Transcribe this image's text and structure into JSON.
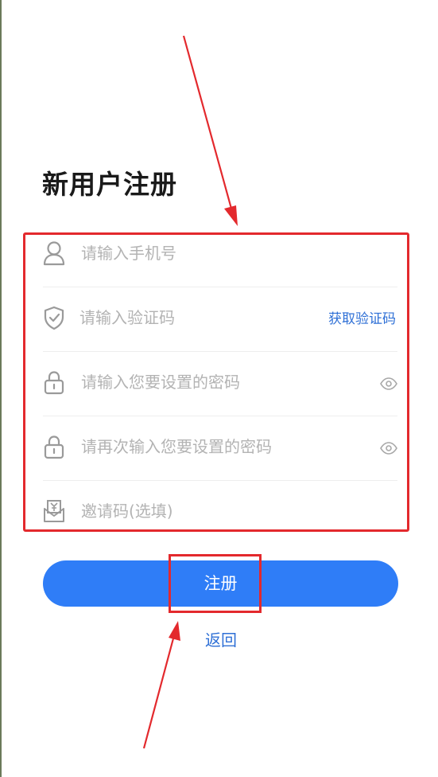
{
  "page_title": "新用户注册",
  "form": {
    "phone_placeholder": "请输入手机号",
    "code_placeholder": "请输入验证码",
    "get_code_label": "获取验证码",
    "password_placeholder": "请输入您要设置的密码",
    "confirm_password_placeholder": "请再次输入您要设置的密码",
    "invite_placeholder": "邀请码(选填)"
  },
  "register_label": "注册",
  "back_label": "返回",
  "colors": {
    "accent": "#2f7df7",
    "link": "#2f70d6",
    "annotation": "#e3292d",
    "placeholder": "#b3b3b3",
    "icon": "#9a9a9a"
  },
  "icons": {
    "phone": "user-icon",
    "code": "shield-check-icon",
    "password": "lock-icon",
    "confirm_password": "lock-icon",
    "invite": "envelope-yuan-icon",
    "toggle": "eye-icon"
  }
}
